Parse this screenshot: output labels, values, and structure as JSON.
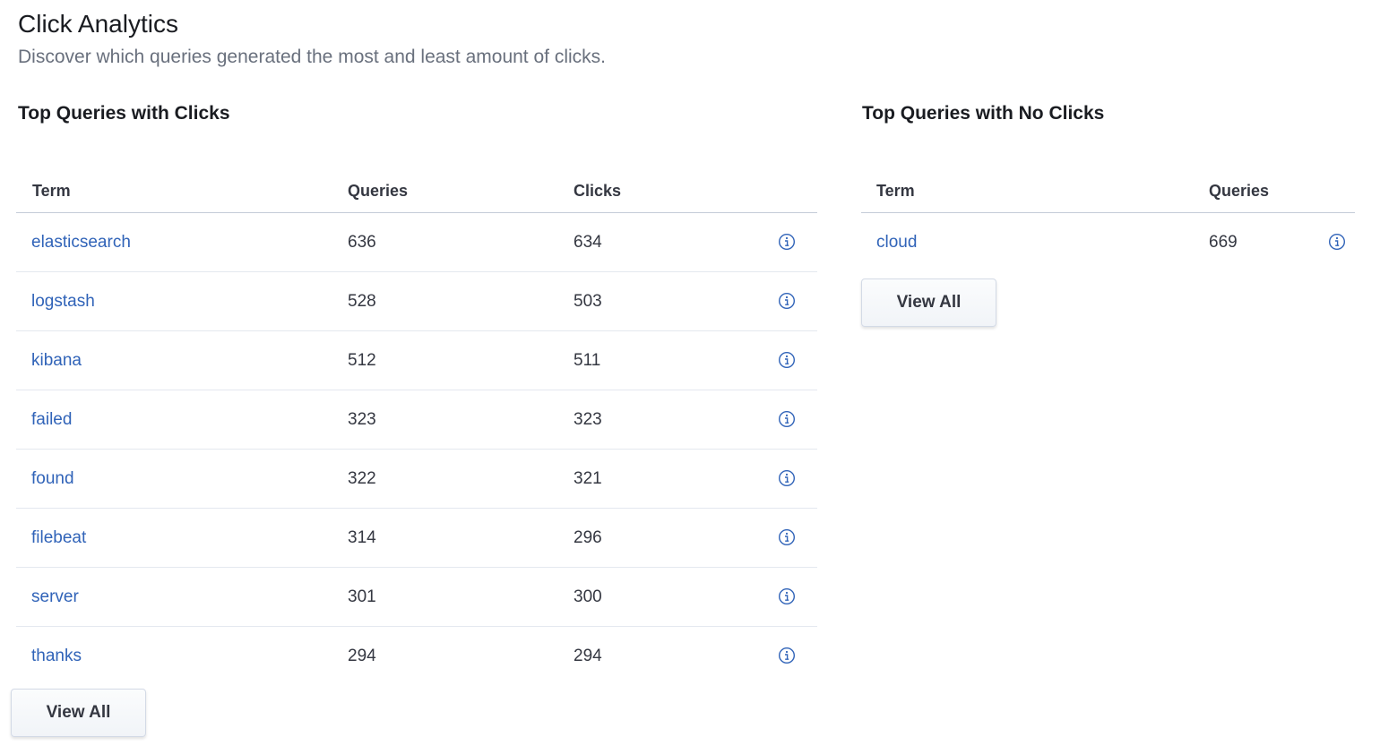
{
  "header": {
    "title": "Click Analytics",
    "subtitle": "Discover which queries generated the most and least amount of clicks."
  },
  "with_clicks": {
    "title": "Top Queries with Clicks",
    "columns": {
      "term": "Term",
      "queries": "Queries",
      "clicks": "Clicks"
    },
    "rows": [
      {
        "term": "elasticsearch",
        "queries": "636",
        "clicks": "634"
      },
      {
        "term": "logstash",
        "queries": "528",
        "clicks": "503"
      },
      {
        "term": "kibana",
        "queries": "512",
        "clicks": "511"
      },
      {
        "term": "failed",
        "queries": "323",
        "clicks": "323"
      },
      {
        "term": "found",
        "queries": "322",
        "clicks": "321"
      },
      {
        "term": "filebeat",
        "queries": "314",
        "clicks": "296"
      },
      {
        "term": "server",
        "queries": "301",
        "clicks": "300"
      },
      {
        "term": "thanks",
        "queries": "294",
        "clicks": "294"
      }
    ],
    "view_all_label": "View All"
  },
  "no_clicks": {
    "title": "Top Queries with No Clicks",
    "columns": {
      "term": "Term",
      "queries": "Queries"
    },
    "rows": [
      {
        "term": "cloud",
        "queries": "669"
      }
    ],
    "view_all_label": "View All"
  },
  "icons": {
    "row_action": "info-icon"
  },
  "colors": {
    "link": "#3063b8",
    "subtitle": "#69707d",
    "text": "#343741"
  }
}
